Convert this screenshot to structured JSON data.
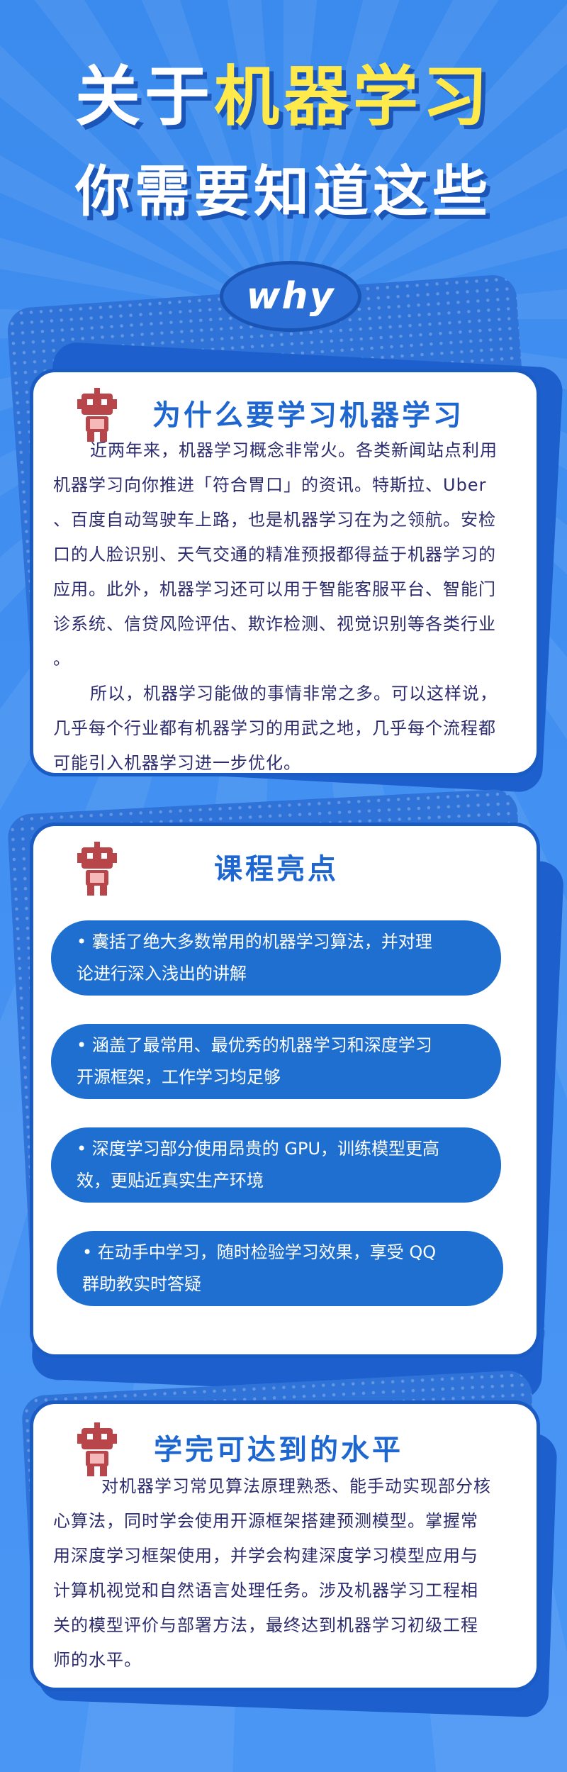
{
  "header": {
    "title_line1_white": "关于",
    "title_line1_yellow": "机器学习",
    "title_line2": "你需要知道这些",
    "why_label": "why"
  },
  "section1": {
    "title": "为什么要学习机器学习",
    "lines": [
      "近两年来，机器学习概念非常火。各类新闻站点利用",
      "机器学习向你推进「符合胃口」的资讯。特斯拉、Uber",
      "、百度自动驾驶车上路，也是机器学习在为之领航。安检",
      "口的人脸识别、天气交通的精准预报都得益于机器学习的",
      "应用。此外，机器学习还可以用于智能客服平台、智能门",
      "诊系统、信贷风险评估、欺诈检测、视觉识别等各类行业",
      "。",
      "所以，机器学习能做的事情非常之多。可以这样说，",
      "几乎每个行业都有机器学习的用武之地，几乎每个流程都",
      "可能引入机器学习进一步优化。"
    ]
  },
  "section2": {
    "title": "课程亮点",
    "items": [
      {
        "line1": "• 囊括了绝大多数常用的机器学习算法，并对理",
        "line2": "论进行深入浅出的讲解"
      },
      {
        "line1": "• 涵盖了最常用、最优秀的机器学习和深度学习",
        "line2": "开源框架，工作学习均足够"
      },
      {
        "line1": "• 深度学习部分使用昂贵的 GPU，训练模型更高",
        "line2": "效，更贴近真实生产环境"
      },
      {
        "line1": "• 在动手中学习，随时检验学习效果，享受 QQ",
        "line2": "群助教实时答疑"
      }
    ]
  },
  "section3": {
    "title": "学完可达到的水平",
    "lines": [
      "对机器学习常见算法原理熟悉、能手动实现部分核",
      "心算法，同时学会使用开源框架搭建预测模型。掌握常",
      "用深度学习框架使用，并学会构建深度学习模型应用与",
      "计算机视觉和自然语言处理任务。涉及机器学习工程相",
      "关的模型评价与部署方法，最终达到机器学习初级工程",
      "师的水平。"
    ]
  },
  "colors": {
    "background": "#3f8ef0",
    "accent_blue": "#1e66d0",
    "title_yellow": "#ffe94b",
    "robot_red": "#b8454a",
    "text_dark": "#2c2c6e"
  },
  "icons": [
    "robot-icon"
  ]
}
